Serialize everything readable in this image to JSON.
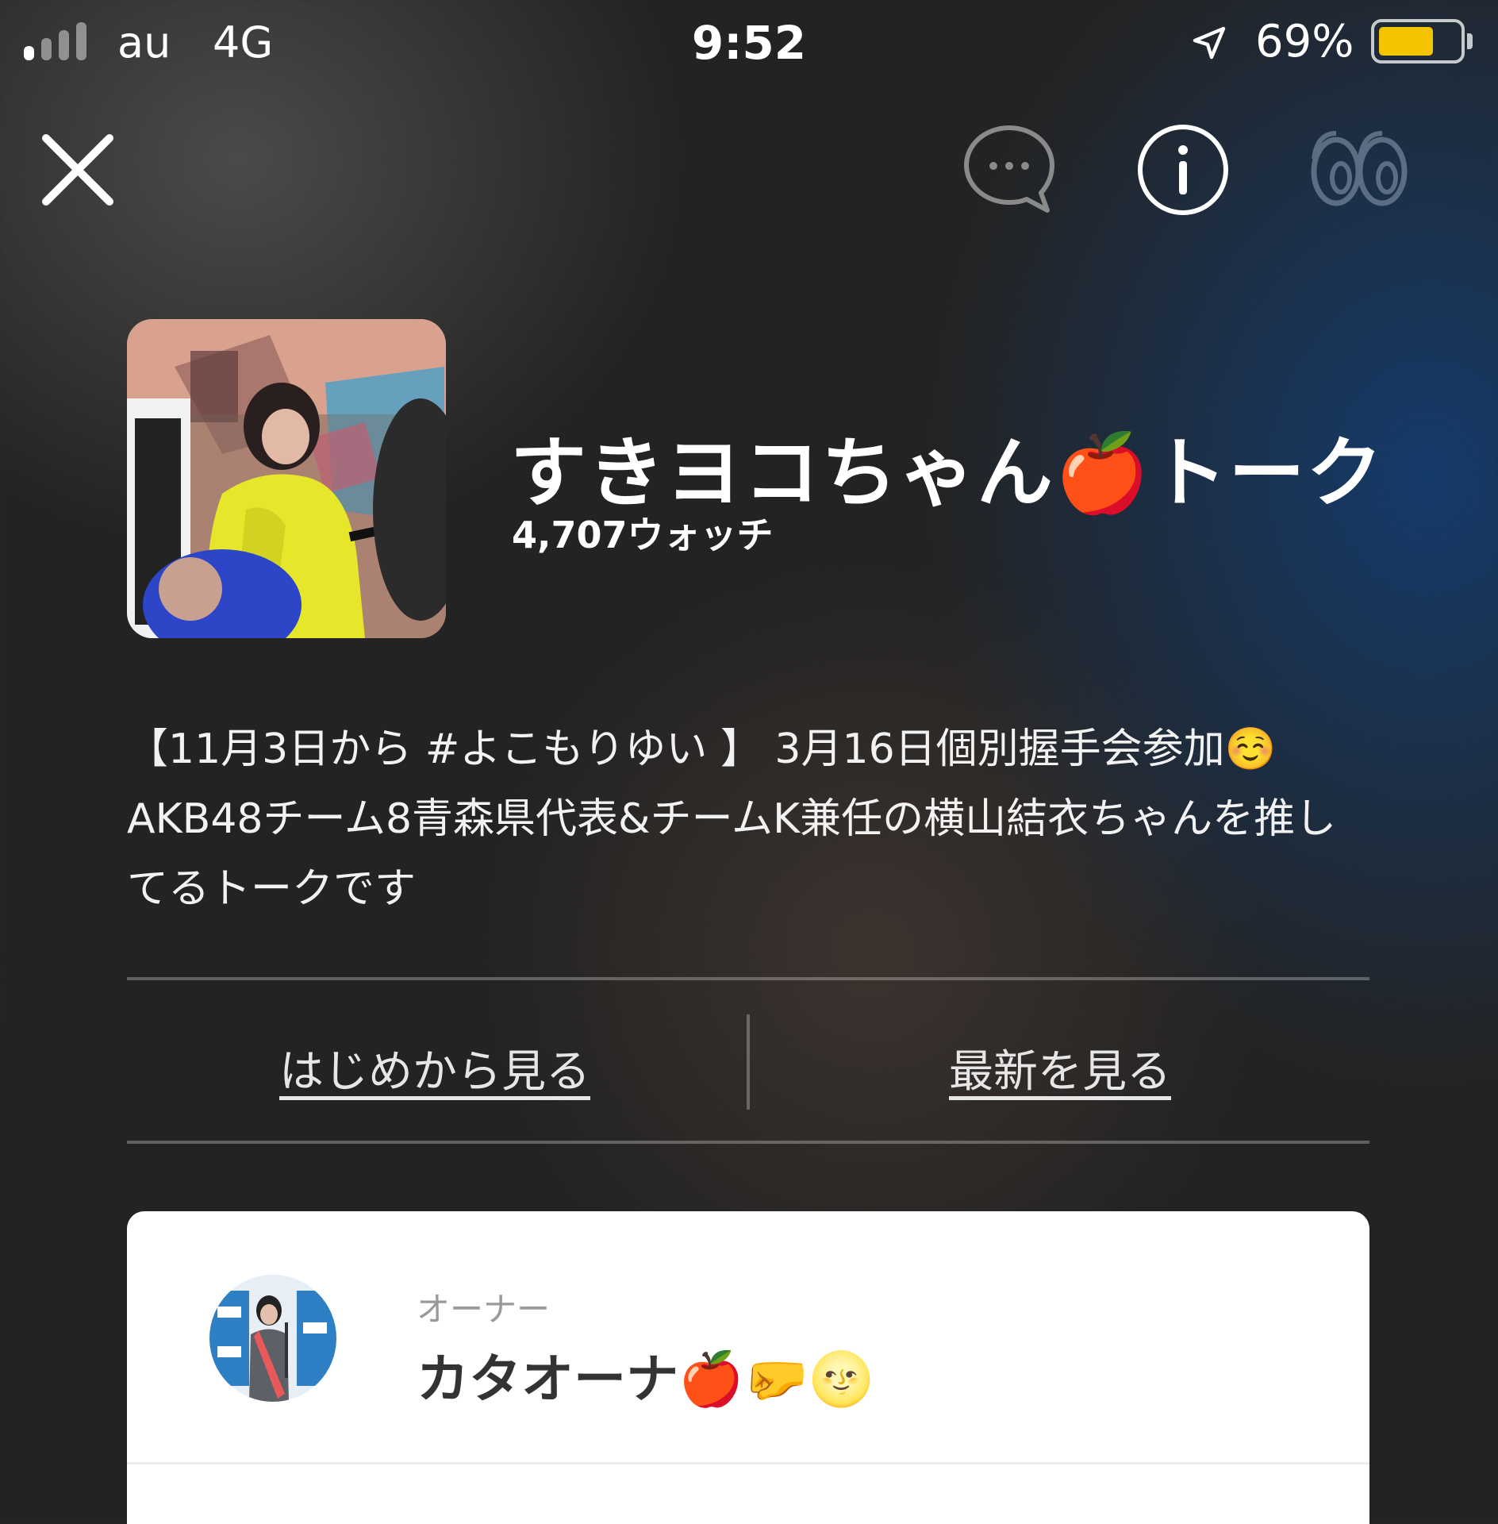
{
  "status_bar": {
    "carrier": "au",
    "network": "4G",
    "time": "9:52",
    "battery_percent": "69%",
    "battery_level": 0.69,
    "signal_bars_active": 1,
    "signal_bars_total": 4
  },
  "nav": {
    "close_icon": "close-icon",
    "chat_icon": "chat-bubble-icon",
    "info_icon": "info-icon",
    "watch_icon": "eyes-icon"
  },
  "talk": {
    "title": "すきヨコちゃん🍎トーク",
    "watch_count": "4,707ウォッチ",
    "description": "【11月3日から #よこもりゆい 】 3月16日個別握手会参加☺️ AKB48チーム8青森県代表&チームK兼任の横山結衣ちゃんを推してるトークです"
  },
  "actions": {
    "from_start": "はじめから見る",
    "latest": "最新を見る"
  },
  "owner": {
    "label": "オーナー",
    "name": "カタオーナ🍎🤛🌝"
  },
  "colors": {
    "battery": "#f5c400",
    "card_bg": "#ffffff",
    "background": "#232323"
  }
}
